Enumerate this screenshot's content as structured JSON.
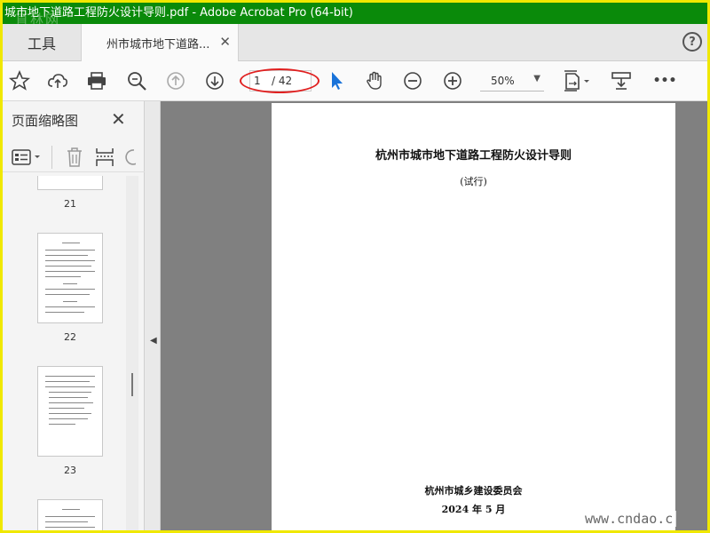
{
  "window": {
    "title": "城市地下道路工程防火设计导则.pdf - Adobe Acrobat Pro (64-bit)",
    "watermark_top": "直林网"
  },
  "tabs": {
    "tools_label": "工具",
    "document_label": "州市城市地下道路...",
    "close_glyph": "✕",
    "help_glyph": "?"
  },
  "toolbar": {
    "page_current": "1",
    "page_total": "/ 42",
    "zoom": "50%",
    "zoom_caret": "▼",
    "more_glyph": "•••",
    "icons": [
      "star-icon",
      "cloud-upload-icon",
      "print-icon",
      "zoom-search-icon",
      "page-up-icon",
      "page-down-icon",
      "select-arrow-icon",
      "hand-icon",
      "zoom-out-icon",
      "zoom-in-icon",
      "fit-page-icon",
      "stamp-icon",
      "more-icon"
    ],
    "accent": "#1a73d9"
  },
  "sidebar": {
    "title": "页面缩略图",
    "close_glyph": "✕",
    "thumbnails": [
      {
        "label": "21"
      },
      {
        "label": "22"
      },
      {
        "label": "23"
      }
    ],
    "collapse_glyph": "◀"
  },
  "document": {
    "title": "杭州市城市地下道路工程防火设计导则",
    "subtitle": "(试行)",
    "issuer": "杭州市城乡建设委员会",
    "date": "2024 年 5 月"
  },
  "watermark": "www.cndao.c",
  "colors": {
    "titlebar": "#0a8a0a",
    "frame": "#f0e800",
    "annotation": "#e02020"
  }
}
